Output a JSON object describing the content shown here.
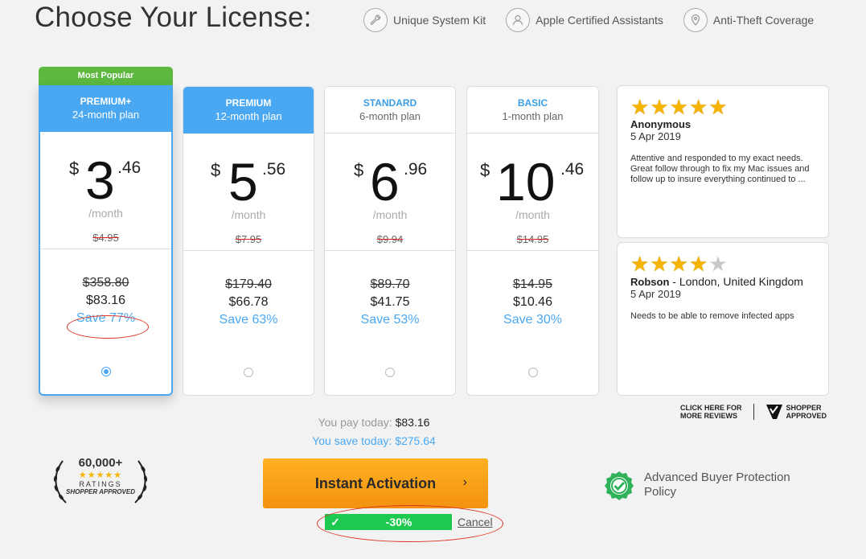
{
  "page": {
    "title": "Choose Your License:"
  },
  "features": [
    {
      "icon": "wrench-icon",
      "label": "Unique System Kit"
    },
    {
      "icon": "user-icon",
      "label": "Apple Certified Assistants"
    },
    {
      "icon": "location-pin-icon",
      "label": "Anti-Theft Coverage"
    }
  ],
  "plans": [
    {
      "badge": "Most Popular",
      "name": "PREMIUM+",
      "period": "24-month plan",
      "currency": "$",
      "whole": "3",
      "cents": ".46",
      "per": "/month",
      "old_monthly": "$4.95",
      "old_total": "$358.80",
      "total": "$83.16",
      "save": "Save 77%",
      "selected": true
    },
    {
      "name": "PREMIUM",
      "period": "12-month plan",
      "currency": "$",
      "whole": "5",
      "cents": ".56",
      "per": "/month",
      "old_monthly": "$7.95",
      "old_total": "$179.40",
      "total": "$66.78",
      "save": "Save 63%",
      "selected": false
    },
    {
      "name": "STANDARD",
      "period": "6-month plan",
      "currency": "$",
      "whole": "6",
      "cents": ".96",
      "per": "/month",
      "old_monthly": "$9.94",
      "old_total": "$89.70",
      "total": "$41.75",
      "save": "Save 53%",
      "selected": false
    },
    {
      "name": "BASIC",
      "period": "1-month plan",
      "currency": "$",
      "whole": "10",
      "cents": ".46",
      "per": "/month",
      "old_monthly": "$14.95",
      "old_total": "$14.95",
      "total": "$10.46",
      "save": "Save 30%",
      "selected": false
    }
  ],
  "reviews": [
    {
      "stars": 5,
      "name": "Anonymous",
      "location": "",
      "date": "5 Apr 2019",
      "text": "Attentive and responded to my exact needs. Great follow through to fix my Mac issues and follow up to insure everything continued to",
      "more": "..."
    },
    {
      "stars": 4,
      "name": "Robson",
      "location": " - London, United Kingdom",
      "date": "5 Apr 2019",
      "text": "Needs to be able to remove infected apps",
      "more": ""
    }
  ],
  "more_reviews": {
    "line1": "CLICK HERE FOR",
    "line2": "MORE REVIEWS",
    "logo1": "SHOPPER",
    "logo2": "APPROVED"
  },
  "summary": {
    "pay_label": "You pay today: ",
    "pay_value": "$83.16",
    "save_label": "You save today: $275.64"
  },
  "ratings_badge": {
    "count": "60,000+",
    "stars": "★★★★★",
    "label": "RATINGS",
    "brand1": "SHOPPER",
    "brand2": "APPROVED"
  },
  "cta": {
    "label": "Instant Activation",
    "chevron": "›"
  },
  "coupon": {
    "check": "✓",
    "discount": "-30%",
    "cancel": "Cancel"
  },
  "protection": {
    "text": "Advanced Buyer Protection Policy"
  },
  "colors": {
    "accent": "#4aa8f3",
    "popular": "#5cb83f",
    "cta": "#f5a31a",
    "coupon": "#1ec94f"
  }
}
